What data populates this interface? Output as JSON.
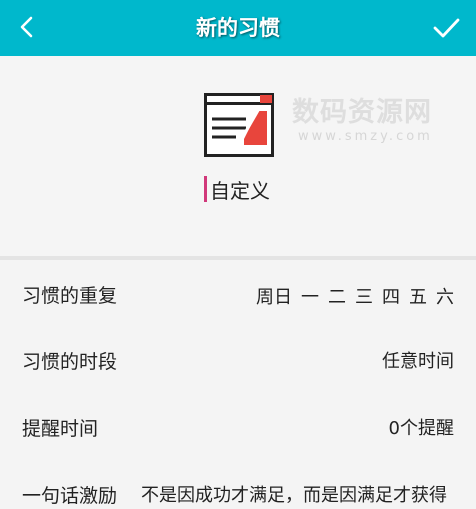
{
  "header": {
    "title": "新的习惯",
    "back_icon": "chevron-left-icon",
    "confirm_icon": "checkmark-icon",
    "color": "#00b8cc"
  },
  "habit": {
    "icon": "notepad-icon",
    "name": "自定义",
    "cursor_color": "#d1387a"
  },
  "watermark": {
    "main": "数码资源网",
    "sub": "www.smzy.com"
  },
  "settings": {
    "repeat": {
      "label": "习惯的重复",
      "days": [
        "周日",
        "一",
        "二",
        "三",
        "四",
        "五",
        "六"
      ]
    },
    "period": {
      "label": "习惯的时段",
      "value": "任意时间"
    },
    "reminder": {
      "label": "提醒时间",
      "value": "0个提醒"
    },
    "motto": {
      "label": "一句话激励",
      "value": "不是因成功才满足，而是因满足才获得"
    }
  }
}
